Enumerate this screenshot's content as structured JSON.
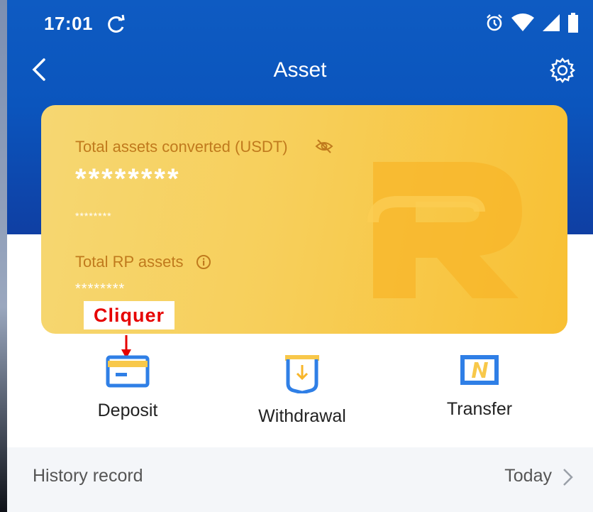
{
  "status_bar": {
    "time": "17:01",
    "icons": [
      "sync-icon",
      "alarm-icon",
      "wifi-icon",
      "signal-icon",
      "battery-icon"
    ]
  },
  "nav": {
    "title": "Asset",
    "back_icon": "chevron-left-icon",
    "settings_icon": "gear-icon"
  },
  "card": {
    "total_assets_label": "Total assets converted (USDT)",
    "total_assets_value": "********",
    "total_assets_sub": "********",
    "rp_label": "Total RP assets",
    "rp_value": "********"
  },
  "annotation": {
    "text": "Cliquer",
    "color": "#e60000"
  },
  "actions": [
    {
      "label": "Deposit",
      "icon": "card-icon"
    },
    {
      "label": "Withdrawal",
      "icon": "withdraw-icon"
    },
    {
      "label": "Transfer",
      "icon": "transfer-icon"
    }
  ],
  "history": {
    "label": "History record",
    "value": "Today"
  },
  "colors": {
    "header_blue": "#0b55bd",
    "card_gold": "#f8c033",
    "accent_blue": "#2f7fe6"
  }
}
